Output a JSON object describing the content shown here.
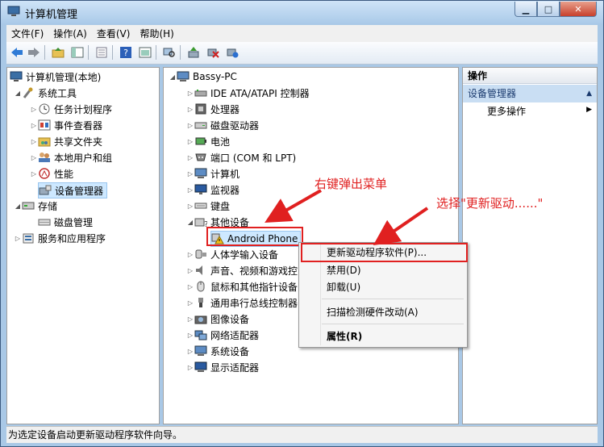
{
  "window": {
    "title": "计算机管理"
  },
  "menubar": [
    "文件(F)",
    "操作(A)",
    "查看(V)",
    "帮助(H)"
  ],
  "left_tree": {
    "root": "计算机管理(本地)",
    "items": [
      {
        "label": "系统工具",
        "level": 1
      },
      {
        "label": "任务计划程序",
        "level": 2
      },
      {
        "label": "事件查看器",
        "level": 2
      },
      {
        "label": "共享文件夹",
        "level": 2
      },
      {
        "label": "本地用户和组",
        "level": 2
      },
      {
        "label": "性能",
        "level": 2
      },
      {
        "label": "设备管理器",
        "level": 2,
        "selected": true
      },
      {
        "label": "存储",
        "level": 1
      },
      {
        "label": "磁盘管理",
        "level": 2
      },
      {
        "label": "服务和应用程序",
        "level": 1
      }
    ]
  },
  "device_tree": {
    "root": "Bassy-PC",
    "items": [
      "IDE ATA/ATAPI 控制器",
      "处理器",
      "磁盘驱动器",
      "电池",
      "端口 (COM 和 LPT)",
      "计算机",
      "监视器",
      "键盘",
      "其他设备",
      "Android Phone",
      "人体学输入设备",
      "声音、视频和游戏控",
      "鼠标和其他指针设备",
      "通用串行总线控制器",
      "图像设备",
      "网络适配器",
      "系统设备",
      "显示适配器"
    ]
  },
  "actions": {
    "header": "操作",
    "section": "设备管理器",
    "more": "更多操作"
  },
  "context_menu": {
    "items": [
      "更新驱动程序软件(P)...",
      "禁用(D)",
      "卸载(U)",
      "扫描检测硬件改动(A)",
      "属性(R)"
    ]
  },
  "annotations": {
    "right_click": "右键弹出菜单",
    "select_update": "选择\"更新驱动......\""
  },
  "statusbar": {
    "text": "为选定设备启动更新驱动程序软件向导。"
  },
  "colors": {
    "selection": "#cde8ff",
    "annotation": "#e02020",
    "accent": "#c9def3"
  }
}
